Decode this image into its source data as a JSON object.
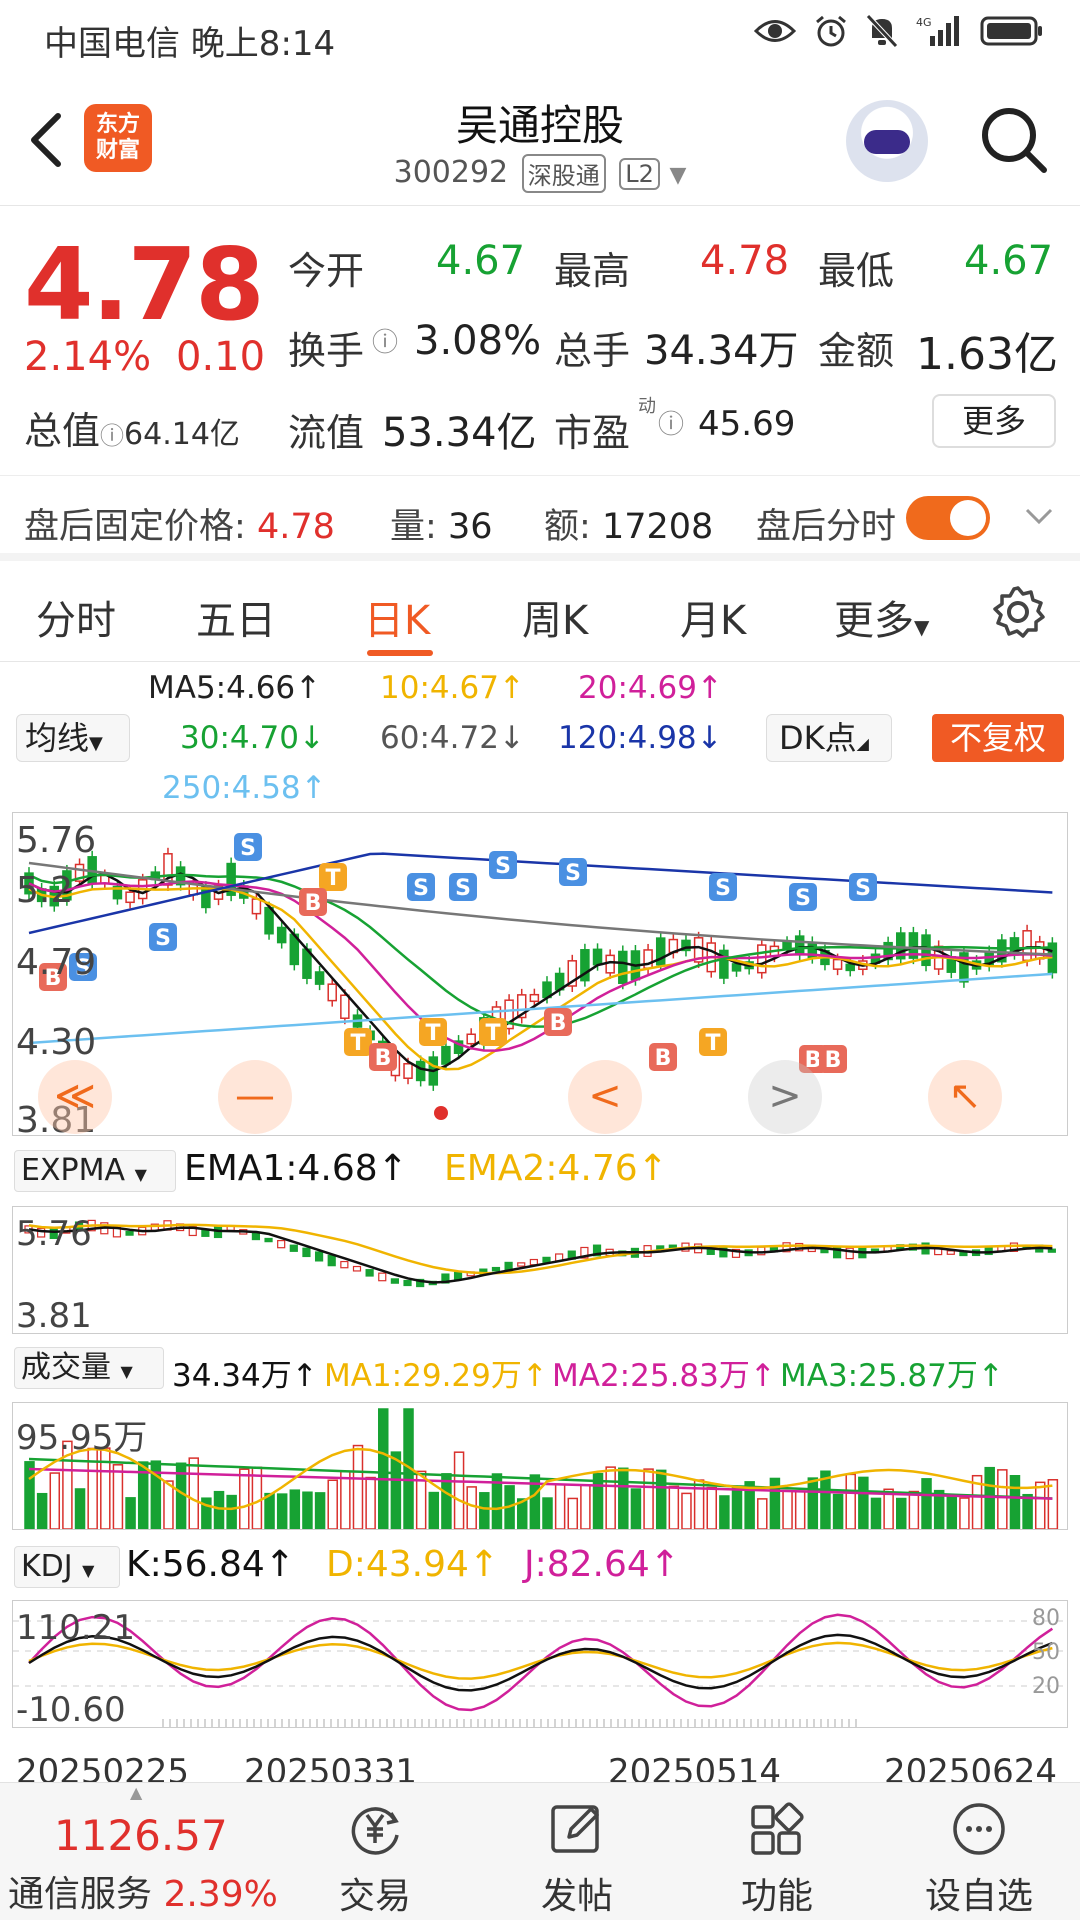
{
  "status_bar": {
    "carrier_time": "中国电信 晚上8:14",
    "network": "4G"
  },
  "header": {
    "logo_text_line1": "东方",
    "logo_text_line2": "财富",
    "stock_name": "吴通控股",
    "stock_code": "300292",
    "tag_connect": "深股通",
    "tag_level": "L2"
  },
  "quote": {
    "price": "4.78",
    "change_pct": "2.14%",
    "change_amt": "0.10",
    "open_label": "今开",
    "open_value": "4.67",
    "high_label": "最高",
    "high_value": "4.78",
    "low_label": "最低",
    "low_value": "4.67",
    "turnover_label": "换手",
    "turnover_value": "3.08%",
    "volume_label": "总手",
    "volume_value": "34.34万",
    "amount_label": "金额",
    "amount_value": "1.63亿",
    "total_cap_label": "总值",
    "total_cap_value": "64.14亿",
    "float_cap_label": "流值",
    "float_cap_value": "53.34亿",
    "pe_label": "市盈",
    "pe_sup": "动",
    "pe_value": "45.69",
    "more_label": "更多"
  },
  "after_hours": {
    "fixed_price_label": "盘后固定价格:",
    "fixed_price_value": "4.78",
    "vol_label": "量:",
    "vol_value": "36",
    "amt_label": "额:",
    "amt_value": "17208",
    "timeshare_label": "盘后分时",
    "toggle_on": true
  },
  "tabs": [
    {
      "label": "分时"
    },
    {
      "label": "五日"
    },
    {
      "label": "日K"
    },
    {
      "label": "周K"
    },
    {
      "label": "月K"
    },
    {
      "label": "更多"
    }
  ],
  "active_tab": "日K",
  "ma_row": {
    "selector": "均线",
    "ma5": "MA5:4.66↑",
    "ma10": "10:4.67↑",
    "ma20": "20:4.69↑",
    "ma30": "30:4.70↓",
    "ma60": "60:4.72↓",
    "ma120": "120:4.98↓",
    "ma250": "250:4.58↑",
    "dk_label": "DK点",
    "adjust_label": "不复权"
  },
  "main_chart": {
    "y_top": "5.76",
    "y_mid1": "5.2",
    "y_mid2": "4.79",
    "y_mid3": "4.30",
    "y_bottom": "3.81",
    "nav_first": "≪",
    "nav_minus": "—",
    "nav_prev": "<",
    "nav_next": ">",
    "nav_last": "↖",
    "colors": {
      "ma5": "#111111",
      "ma10": "#f0b400",
      "ma20": "#d0209a",
      "ma30": "#17a233",
      "ma60": "#777777",
      "ma120": "#1a35a8",
      "ma250": "#6cc0f0"
    }
  },
  "expma": {
    "selector": "EXPMA",
    "ema1": "EMA1:4.68↑",
    "ema2": "EMA2:4.76↑",
    "y_top": "5.76",
    "y_bottom": "3.81"
  },
  "volume": {
    "selector": "成交量",
    "vol": "34.34万↑",
    "ma1": "MA1:29.29万↑",
    "ma2": "MA2:25.83万↑",
    "ma3": "MA3:25.87万↑",
    "y_top": "95.95万"
  },
  "kdj": {
    "selector": "KDJ",
    "k": "K:56.84↑",
    "d": "D:43.94↑",
    "j": "J:82.64↑",
    "y_top": "110.21",
    "y_bottom": "-10.60",
    "r80": "80",
    "r50": "50",
    "r20": "20"
  },
  "dates": [
    "20250225",
    "20250331",
    "20250514",
    "20250624"
  ],
  "bottom_bar": {
    "index_value": "1126.57",
    "index_name": "通信服务",
    "index_pct": "2.39%",
    "buttons": [
      {
        "label": "交易",
        "icon": "yen-trade-icon"
      },
      {
        "label": "发帖",
        "icon": "edit-icon"
      },
      {
        "label": "功能",
        "icon": "grid-icon"
      },
      {
        "label": "设自选",
        "icon": "more-circle-icon"
      }
    ]
  }
}
